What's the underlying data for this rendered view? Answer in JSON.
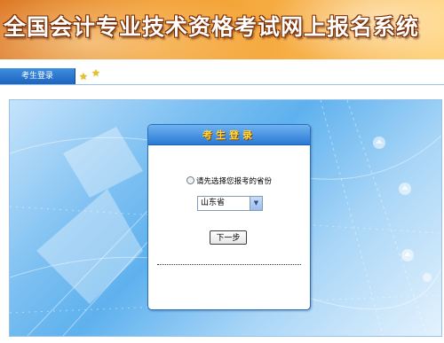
{
  "header": {
    "title": "全国会计专业技术资格考试网上报名系统"
  },
  "nav": {
    "login_tab": "考生登录",
    "icons": [
      "star-icon",
      "star-icon"
    ]
  },
  "login_box": {
    "title": "考生登录",
    "province_label": "请先选择您报考的省份",
    "province_selected": "山东省",
    "next_button": "下一步"
  },
  "colors": {
    "banner_orange": "#f29a2a",
    "nav_blue": "#1d64bf",
    "panel_blue": "#5eb1ee",
    "login_title_yellow": "#ffdc3a"
  }
}
